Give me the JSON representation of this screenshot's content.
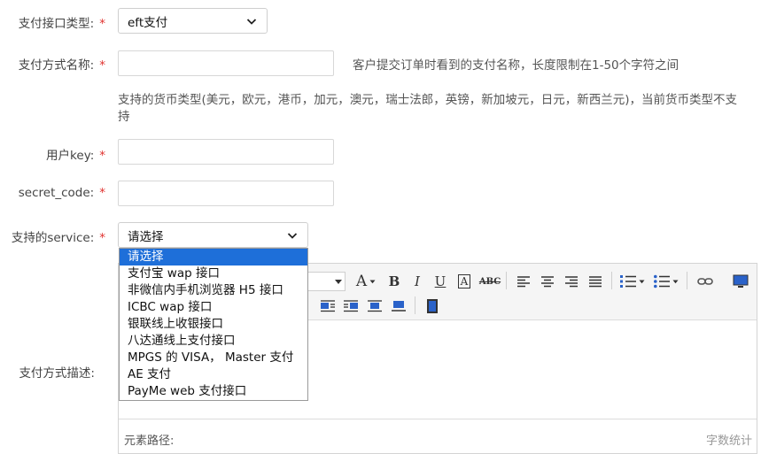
{
  "form": {
    "interface_type": {
      "label": "支付接口类型:",
      "value": "eft支付"
    },
    "method_name": {
      "label": "支付方式名称:",
      "value": "",
      "hint": "客户提交订单时看到的支付名称，长度限制在1-50个字符之间"
    },
    "currency_note": {
      "line1": "支持的货币类型(美元，欧元，港币，加元，澳元，瑞士法郎，英镑，新加坡元，日元，新西兰元)，当前货币类型不支",
      "line2": "持"
    },
    "user_key": {
      "label": "用户key:",
      "value": ""
    },
    "secret_code": {
      "label": "secret_code:",
      "value": ""
    },
    "service": {
      "label": "支持的service:",
      "value": "请选择",
      "options": [
        "请选择",
        "支付宝 wap 接口",
        "非微信内手机浏览器 H5 接口",
        "ICBC wap 接口",
        "银联线上收银接口",
        "八达通线上支付接口",
        "MPGS 的 VISA， Master 支付",
        "AE 支付",
        "PayMe web 支付接口"
      ],
      "selected_index": 0
    },
    "description": {
      "label": "支付方式描述:"
    },
    "required_mark": "*"
  },
  "editor": {
    "footer_path_label": "元素路径:",
    "footer_count_label": "字数统计",
    "toolbar_glyphs": {
      "font_color": "A",
      "bold": "B",
      "italic": "I",
      "underline": "U",
      "border_a": "A",
      "strike": "ABC"
    }
  },
  "colors": {
    "required": "#e0312e",
    "selected_option": "#1e6fd9",
    "toolbar_bg": "#f5f5f5"
  }
}
